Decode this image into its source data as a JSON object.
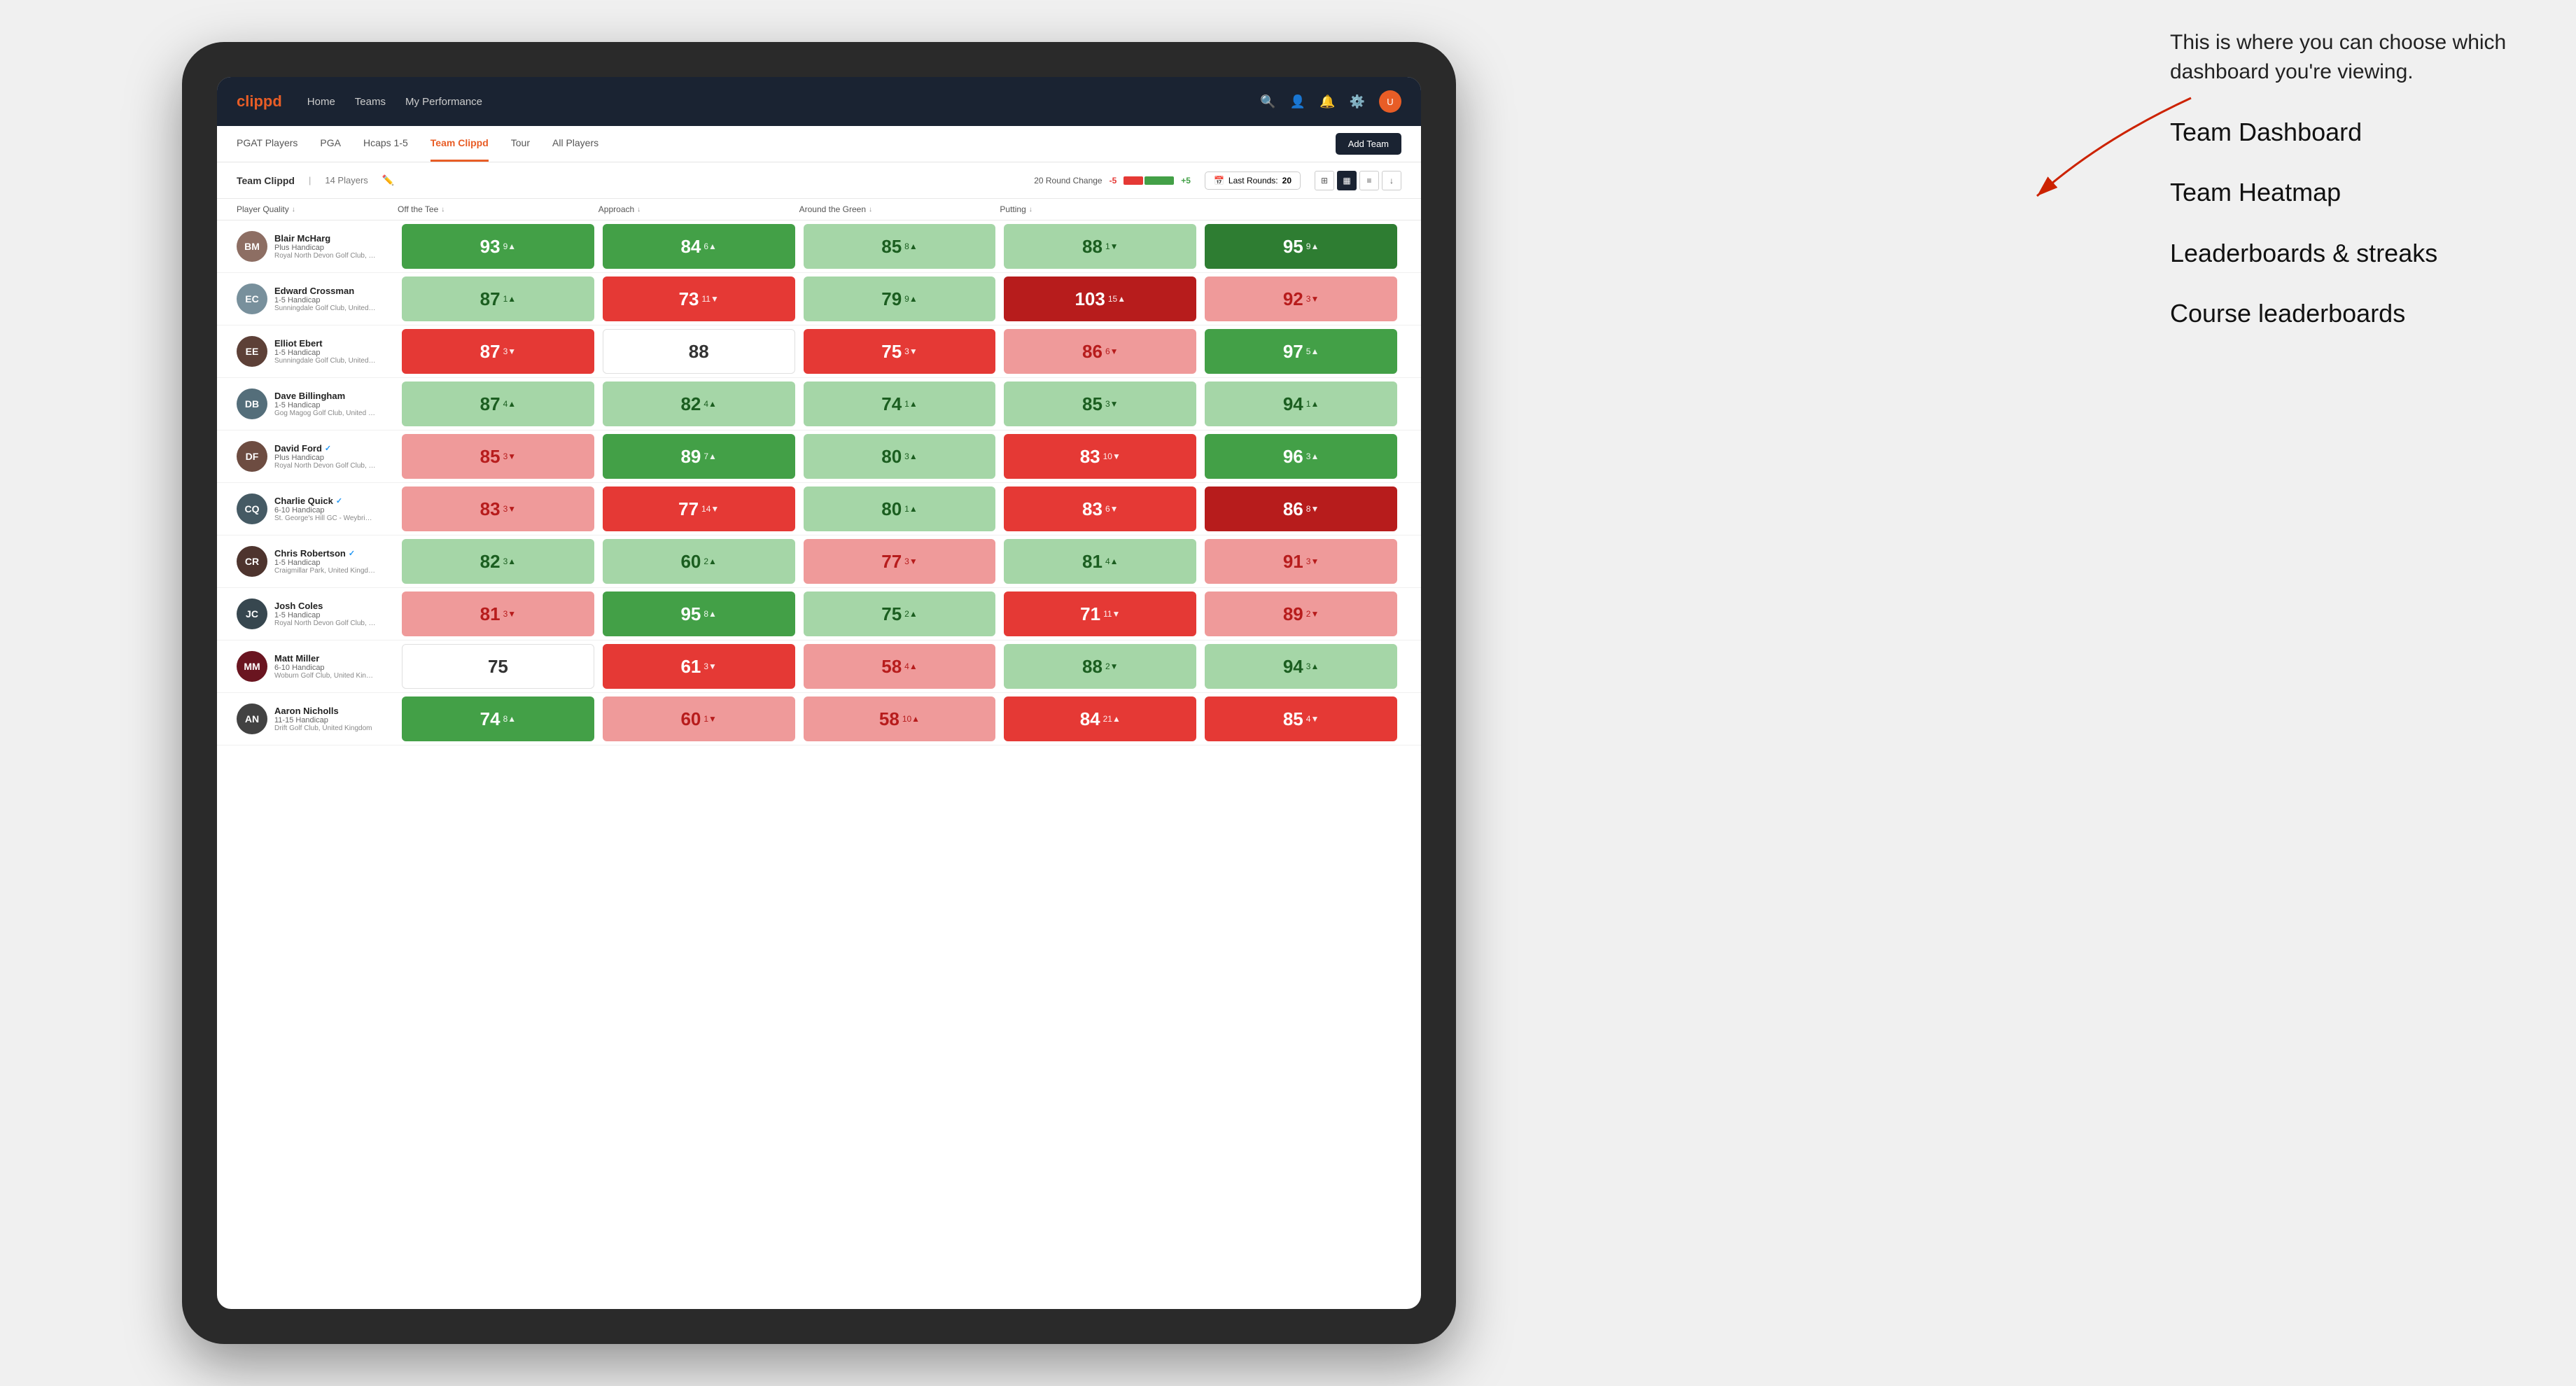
{
  "annotation": {
    "intro_text": "This is where you can choose which dashboard you're viewing.",
    "options": [
      {
        "label": "Team Dashboard"
      },
      {
        "label": "Team Heatmap"
      },
      {
        "label": "Leaderboards & streaks"
      },
      {
        "label": "Course leaderboards"
      }
    ]
  },
  "nav": {
    "logo": "clippd",
    "links": [
      {
        "label": "Home",
        "active": false
      },
      {
        "label": "Teams",
        "active": false
      },
      {
        "label": "My Performance",
        "active": false
      }
    ],
    "add_team_label": "Add Team"
  },
  "sub_nav": {
    "links": [
      {
        "label": "PGAT Players",
        "active": false
      },
      {
        "label": "PGA",
        "active": false
      },
      {
        "label": "Hcaps 1-5",
        "active": false
      },
      {
        "label": "Team Clippd",
        "active": true
      },
      {
        "label": "Tour",
        "active": false
      },
      {
        "label": "All Players",
        "active": false
      }
    ]
  },
  "team_header": {
    "name": "Team Clippd",
    "separator": "|",
    "count": "14 Players",
    "round_change_label": "20 Round Change",
    "change_neg": "-5",
    "change_pos": "+5",
    "last_rounds_label": "Last Rounds:",
    "last_rounds_value": "20"
  },
  "col_headers": [
    {
      "label": "Player Quality",
      "arrow": "↓"
    },
    {
      "label": "Off the Tee",
      "arrow": "↓"
    },
    {
      "label": "Approach",
      "arrow": "↓"
    },
    {
      "label": "Around the Green",
      "arrow": "↓"
    },
    {
      "label": "Putting",
      "arrow": "↓"
    }
  ],
  "players": [
    {
      "name": "Blair McHarg",
      "hcap": "Plus Handicap",
      "club": "Royal North Devon Golf Club, United Kingdom",
      "initials": "BM",
      "avatar_bg": "#8d6e63",
      "scores": [
        {
          "value": "93",
          "change": "9▲",
          "color": "green"
        },
        {
          "value": "84",
          "change": "6▲",
          "color": "green"
        },
        {
          "value": "85",
          "change": "8▲",
          "color": "light-green"
        },
        {
          "value": "88",
          "change": "1▼",
          "color": "light-green"
        },
        {
          "value": "95",
          "change": "9▲",
          "color": "dark-green"
        }
      ]
    },
    {
      "name": "Edward Crossman",
      "hcap": "1-5 Handicap",
      "club": "Sunningdale Golf Club, United Kingdom",
      "initials": "EC",
      "avatar_bg": "#78909c",
      "scores": [
        {
          "value": "87",
          "change": "1▲",
          "color": "light-green"
        },
        {
          "value": "73",
          "change": "11▼",
          "color": "red"
        },
        {
          "value": "79",
          "change": "9▲",
          "color": "light-green"
        },
        {
          "value": "103",
          "change": "15▲",
          "color": "dark-red"
        },
        {
          "value": "92",
          "change": "3▼",
          "color": "light-red"
        }
      ]
    },
    {
      "name": "Elliot Ebert",
      "hcap": "1-5 Handicap",
      "club": "Sunningdale Golf Club, United Kingdom",
      "initials": "EE",
      "avatar_bg": "#5d4037",
      "scores": [
        {
          "value": "87",
          "change": "3▼",
          "color": "red"
        },
        {
          "value": "88",
          "change": "",
          "color": "white"
        },
        {
          "value": "75",
          "change": "3▼",
          "color": "red"
        },
        {
          "value": "86",
          "change": "6▼",
          "color": "light-red"
        },
        {
          "value": "97",
          "change": "5▲",
          "color": "green"
        }
      ]
    },
    {
      "name": "Dave Billingham",
      "hcap": "1-5 Handicap",
      "club": "Gog Magog Golf Club, United Kingdom",
      "initials": "DB",
      "avatar_bg": "#546e7a",
      "scores": [
        {
          "value": "87",
          "change": "4▲",
          "color": "light-green"
        },
        {
          "value": "82",
          "change": "4▲",
          "color": "light-green"
        },
        {
          "value": "74",
          "change": "1▲",
          "color": "light-green"
        },
        {
          "value": "85",
          "change": "3▼",
          "color": "light-green"
        },
        {
          "value": "94",
          "change": "1▲",
          "color": "light-green"
        }
      ]
    },
    {
      "name": "David Ford",
      "verified": true,
      "hcap": "Plus Handicap",
      "club": "Royal North Devon Golf Club, United Kingdom",
      "initials": "DF",
      "avatar_bg": "#6d4c41",
      "scores": [
        {
          "value": "85",
          "change": "3▼",
          "color": "light-red"
        },
        {
          "value": "89",
          "change": "7▲",
          "color": "green"
        },
        {
          "value": "80",
          "change": "3▲",
          "color": "light-green"
        },
        {
          "value": "83",
          "change": "10▼",
          "color": "red"
        },
        {
          "value": "96",
          "change": "3▲",
          "color": "green"
        }
      ]
    },
    {
      "name": "Charlie Quick",
      "verified": true,
      "hcap": "6-10 Handicap",
      "club": "St. George's Hill GC - Weybridge - Surrey, Uni...",
      "initials": "CQ",
      "avatar_bg": "#455a64",
      "scores": [
        {
          "value": "83",
          "change": "3▼",
          "color": "light-red"
        },
        {
          "value": "77",
          "change": "14▼",
          "color": "red"
        },
        {
          "value": "80",
          "change": "1▲",
          "color": "light-green"
        },
        {
          "value": "83",
          "change": "6▼",
          "color": "red"
        },
        {
          "value": "86",
          "change": "8▼",
          "color": "dark-red"
        }
      ]
    },
    {
      "name": "Chris Robertson",
      "verified": true,
      "hcap": "1-5 Handicap",
      "club": "Craigmillar Park, United Kingdom",
      "initials": "CR",
      "avatar_bg": "#4e342e",
      "scores": [
        {
          "value": "82",
          "change": "3▲",
          "color": "light-green"
        },
        {
          "value": "60",
          "change": "2▲",
          "color": "light-green"
        },
        {
          "value": "77",
          "change": "3▼",
          "color": "light-red"
        },
        {
          "value": "81",
          "change": "4▲",
          "color": "light-green"
        },
        {
          "value": "91",
          "change": "3▼",
          "color": "light-red"
        }
      ]
    },
    {
      "name": "Josh Coles",
      "hcap": "1-5 Handicap",
      "club": "Royal North Devon Golf Club, United Kingdom",
      "initials": "JC",
      "avatar_bg": "#37474f",
      "scores": [
        {
          "value": "81",
          "change": "3▼",
          "color": "light-red"
        },
        {
          "value": "95",
          "change": "8▲",
          "color": "green"
        },
        {
          "value": "75",
          "change": "2▲",
          "color": "light-green"
        },
        {
          "value": "71",
          "change": "11▼",
          "color": "red"
        },
        {
          "value": "89",
          "change": "2▼",
          "color": "light-red"
        }
      ]
    },
    {
      "name": "Matt Miller",
      "hcap": "6-10 Handicap",
      "club": "Woburn Golf Club, United Kingdom",
      "initials": "MM",
      "avatar_bg": "#6a1520",
      "scores": [
        {
          "value": "75",
          "change": "",
          "color": "white"
        },
        {
          "value": "61",
          "change": "3▼",
          "color": "red"
        },
        {
          "value": "58",
          "change": "4▲",
          "color": "light-red"
        },
        {
          "value": "88",
          "change": "2▼",
          "color": "light-green"
        },
        {
          "value": "94",
          "change": "3▲",
          "color": "light-green"
        }
      ]
    },
    {
      "name": "Aaron Nicholls",
      "hcap": "11-15 Handicap",
      "club": "Drift Golf Club, United Kingdom",
      "initials": "AN",
      "avatar_bg": "#424242",
      "scores": [
        {
          "value": "74",
          "change": "8▲",
          "color": "green"
        },
        {
          "value": "60",
          "change": "1▼",
          "color": "light-red"
        },
        {
          "value": "58",
          "change": "10▲",
          "color": "light-red"
        },
        {
          "value": "84",
          "change": "21▲",
          "color": "red"
        },
        {
          "value": "85",
          "change": "4▼",
          "color": "red"
        }
      ]
    }
  ]
}
